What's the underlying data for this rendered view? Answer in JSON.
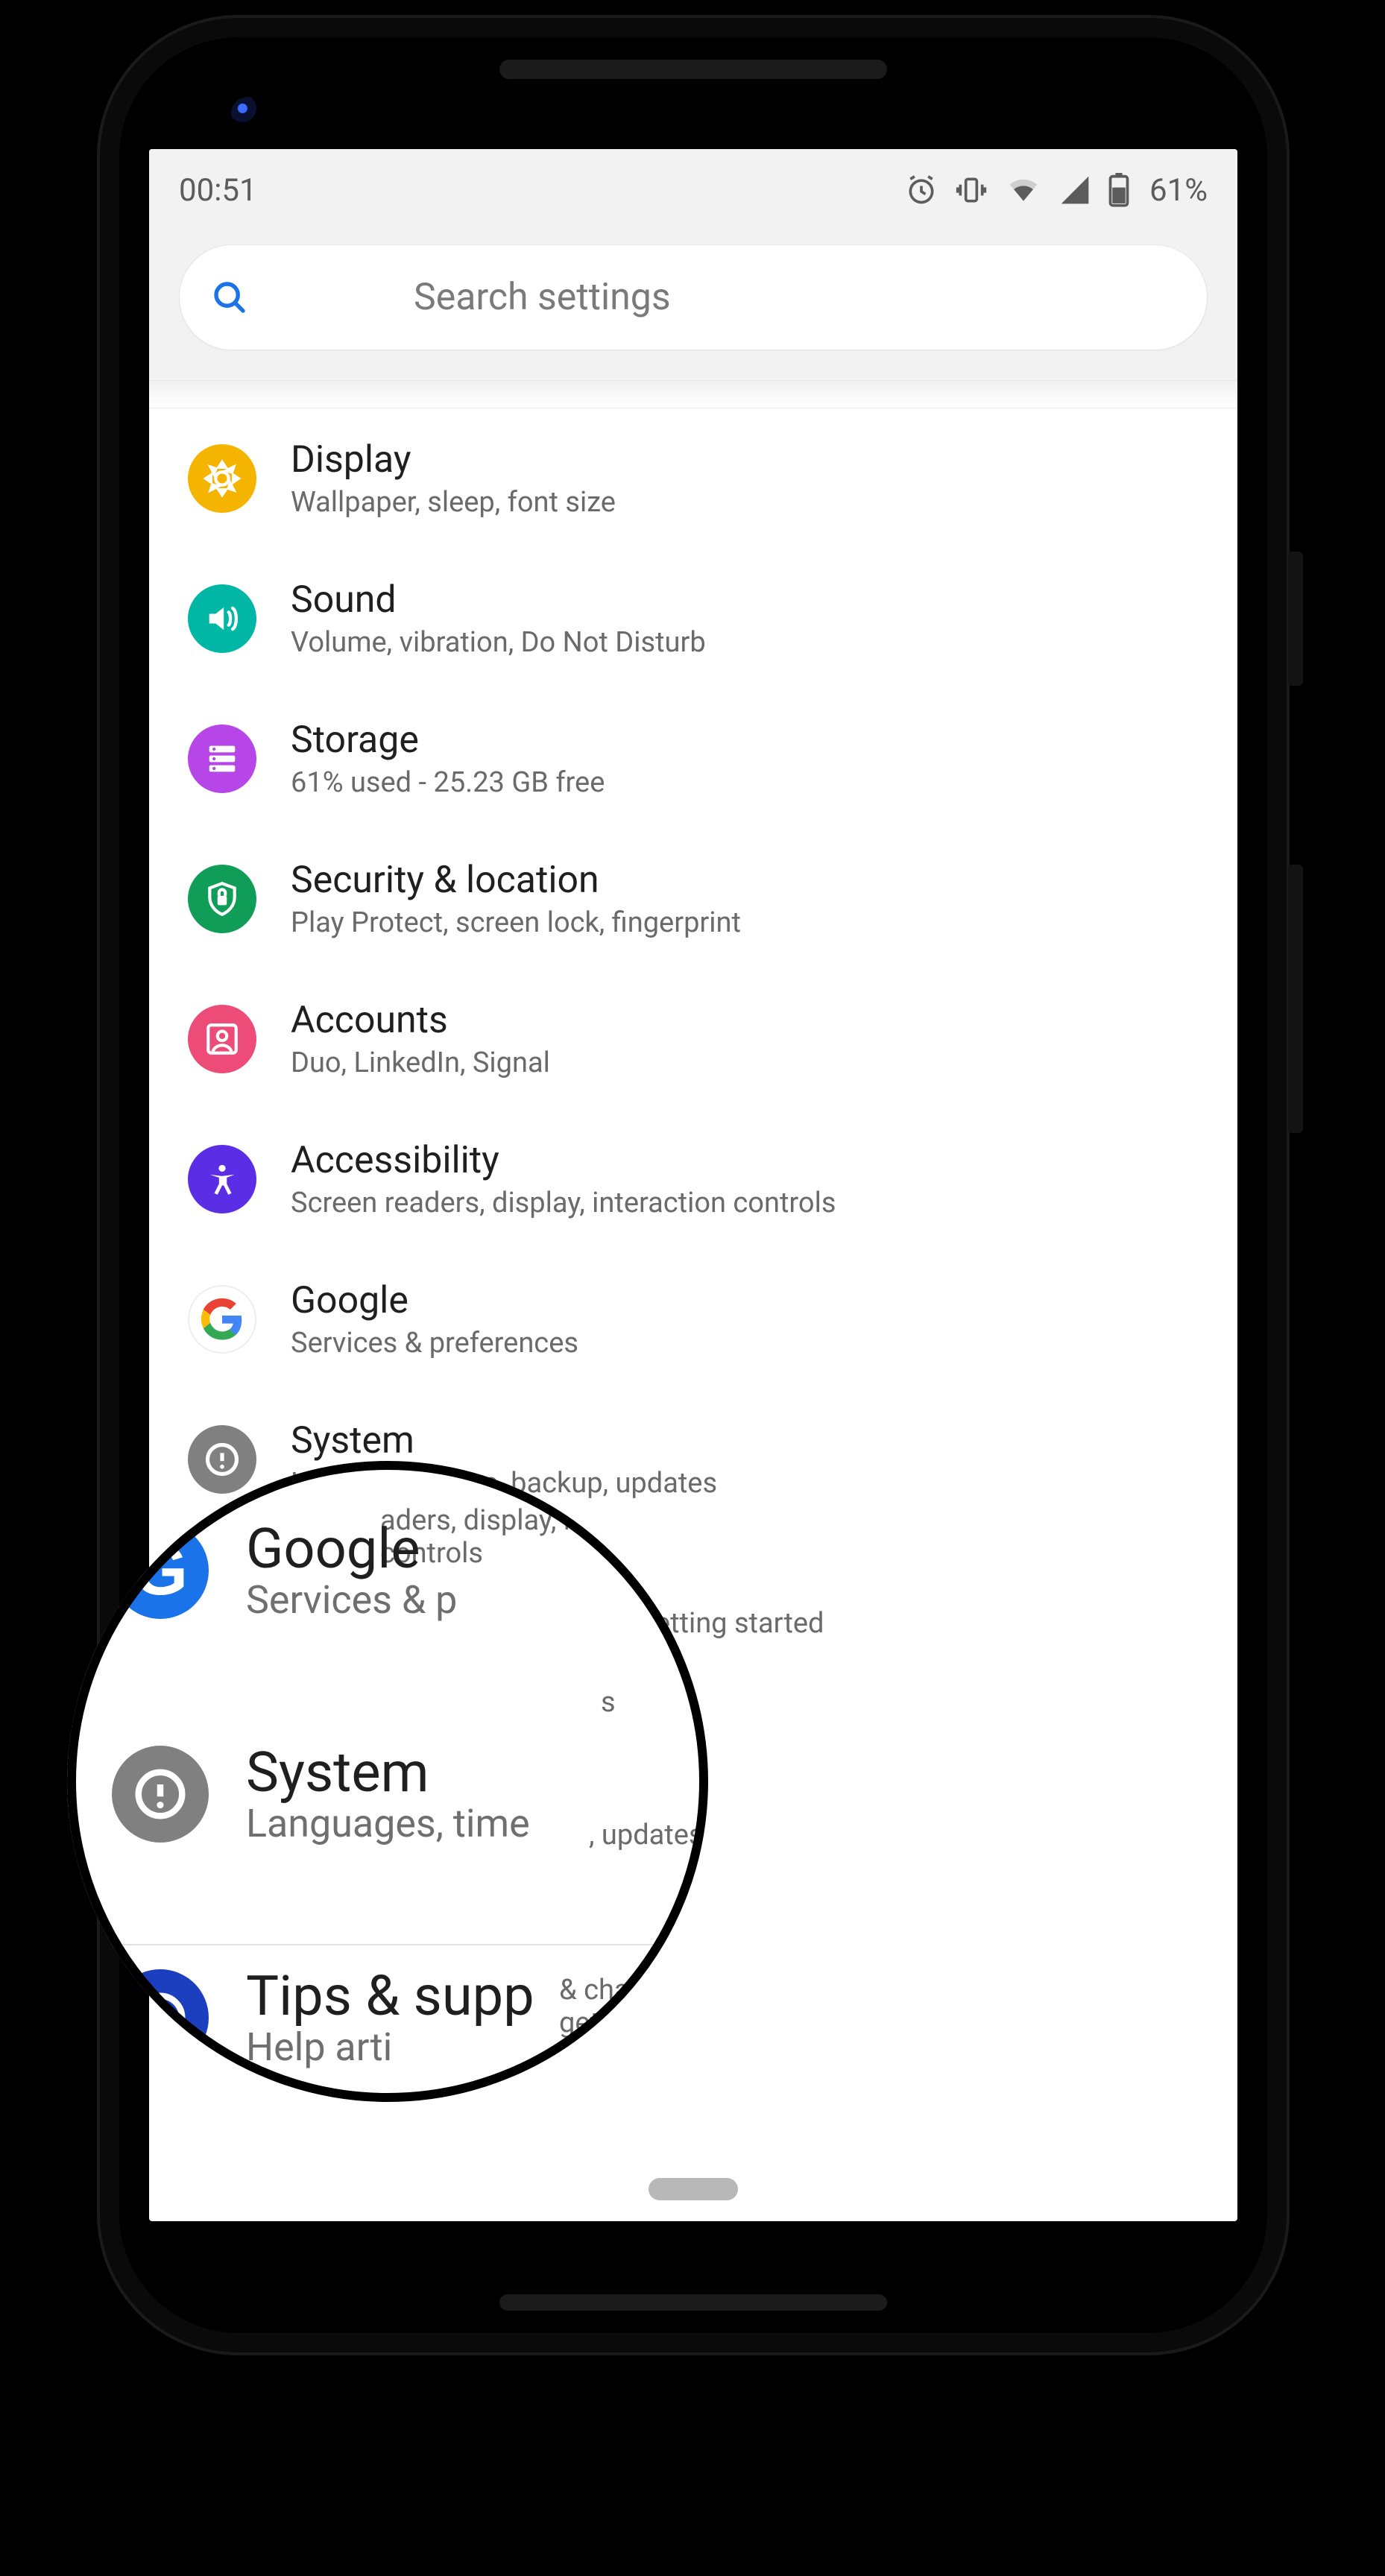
{
  "statusbar": {
    "time": "00:51",
    "battery_pct": "61%"
  },
  "search": {
    "placeholder": "Search settings"
  },
  "items": {
    "display": {
      "title": "Display",
      "sub": "Wallpaper, sleep, font size"
    },
    "sound": {
      "title": "Sound",
      "sub": "Volume, vibration, Do Not Disturb"
    },
    "storage": {
      "title": "Storage",
      "sub": "61% used - 25.23 GB free"
    },
    "security": {
      "title": "Security & location",
      "sub": "Play Protect, screen lock, fingerprint"
    },
    "accounts": {
      "title": "Accounts",
      "sub": "Duo, LinkedIn, Signal"
    },
    "access": {
      "title": "Accessibility",
      "sub": "Screen readers, display, interaction controls"
    },
    "google": {
      "title": "Google",
      "sub": "Services & preferences"
    },
    "system": {
      "title": "System",
      "sub": "Languages, time, backup, updates"
    },
    "tips": {
      "title": "Tips & support",
      "sub": "Help articles, phone & chat, getting started"
    }
  },
  "lens": {
    "google": {
      "title": "Google",
      "sub": "Services & p"
    },
    "system": {
      "title": "System",
      "sub_left": "Languages, time",
      "sub_right": ", updates"
    },
    "tips": {
      "title": "Tips & supp",
      "sub_left": "Help arti",
      "sub_right": "& chat, getting started"
    },
    "access_sub_right": "aders, display, interaction controls"
  }
}
